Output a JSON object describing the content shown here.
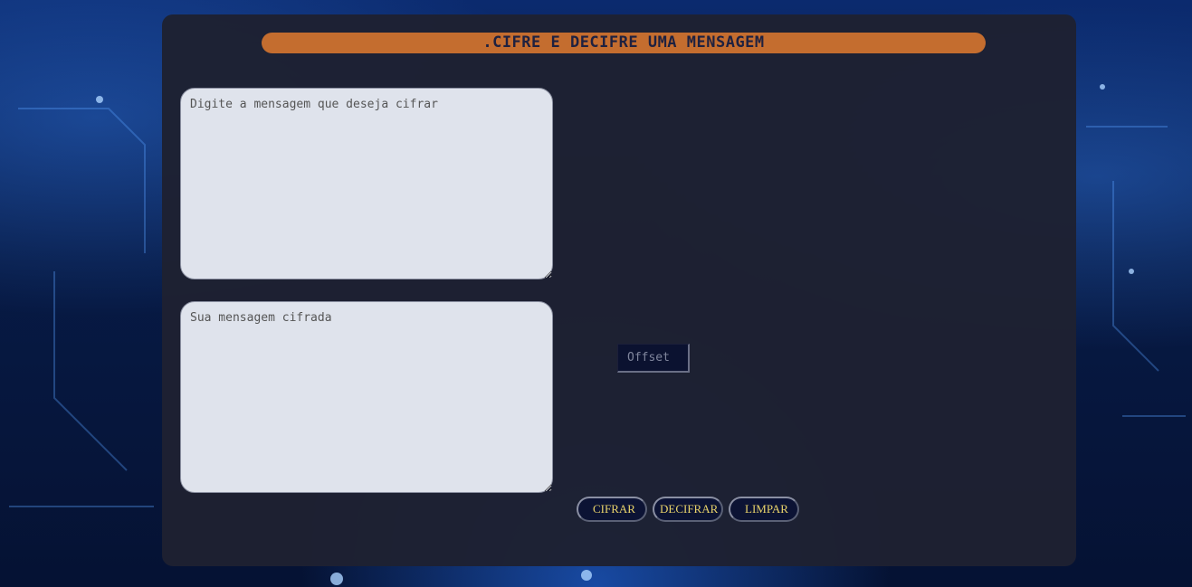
{
  "header": {
    "title": ".CIFRE E DECIFRE UMA MENSAGEM"
  },
  "input_message": {
    "value": "",
    "placeholder": "Digite a mensagem que deseja cifrar"
  },
  "output_message": {
    "value": "",
    "placeholder": "Sua mensagem cifrada"
  },
  "offset": {
    "value": "",
    "placeholder": "Offset"
  },
  "buttons": {
    "encrypt_label": "CIFRAR",
    "decrypt_label": "DECIFRAR",
    "clear_label": "LIMPAR"
  },
  "colors": {
    "title_bar": "#c46d2f",
    "panel": "#1e2132",
    "button_text": "#e9d36a",
    "background": "#0b2a6e"
  }
}
